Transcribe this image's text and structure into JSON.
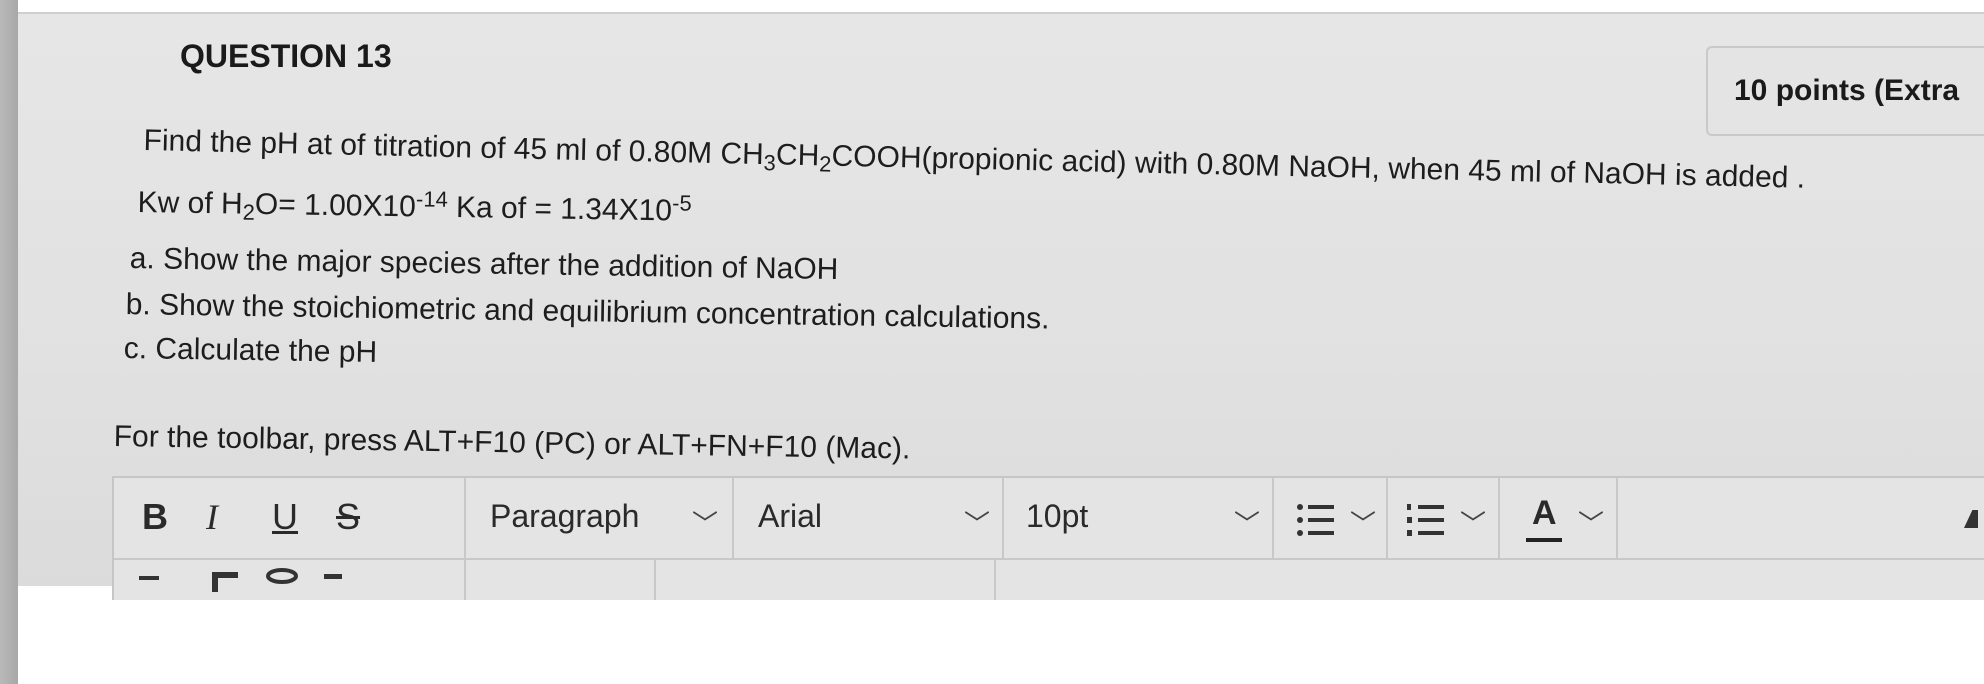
{
  "question": {
    "title": "QUESTION 13",
    "points": "10 points (Extra",
    "line1": {
      "a": "Find the pH at of titration of 45 ml of 0.80M CH",
      "s1": "3",
      "b": "CH",
      "s2": "2",
      "c": "COOH(propionic acid) with 0.80M NaOH,  when 45 ml of NaOH is added ."
    },
    "line2": {
      "a": "Kw of H",
      "s1": "2",
      "b": "O=  1.00X10",
      "e1": "-14",
      "c": " Ka of =  1.34X10",
      "e2": "-5"
    },
    "part_a": "a. Show the major species after the addition of NaOH",
    "part_b": "b. Show the stoichiometric and equilibrium concentration calculations.",
    "part_c": "c. Calculate the pH"
  },
  "editor": {
    "toolbar_hint": "For the toolbar, press ALT+F10 (PC) or ALT+FN+F10 (Mac).",
    "bold_label": "B",
    "italic_label": "I",
    "underline_label": "U",
    "strike_label": "S",
    "paragraph_value": "Paragraph",
    "font_value": "Arial",
    "size_value": "10pt",
    "font_color_label": "A",
    "chevron": "﹀"
  },
  "icons": {
    "bullet_list": "bullet-list-icon",
    "numbered_list": "numbered-list-icon",
    "font_color": "font-color-icon",
    "dropdown": "chevron-down-icon"
  },
  "colors": {
    "card_bg": "#e3e3e3",
    "text": "#1d1d1d",
    "border": "#c8c8c8"
  }
}
